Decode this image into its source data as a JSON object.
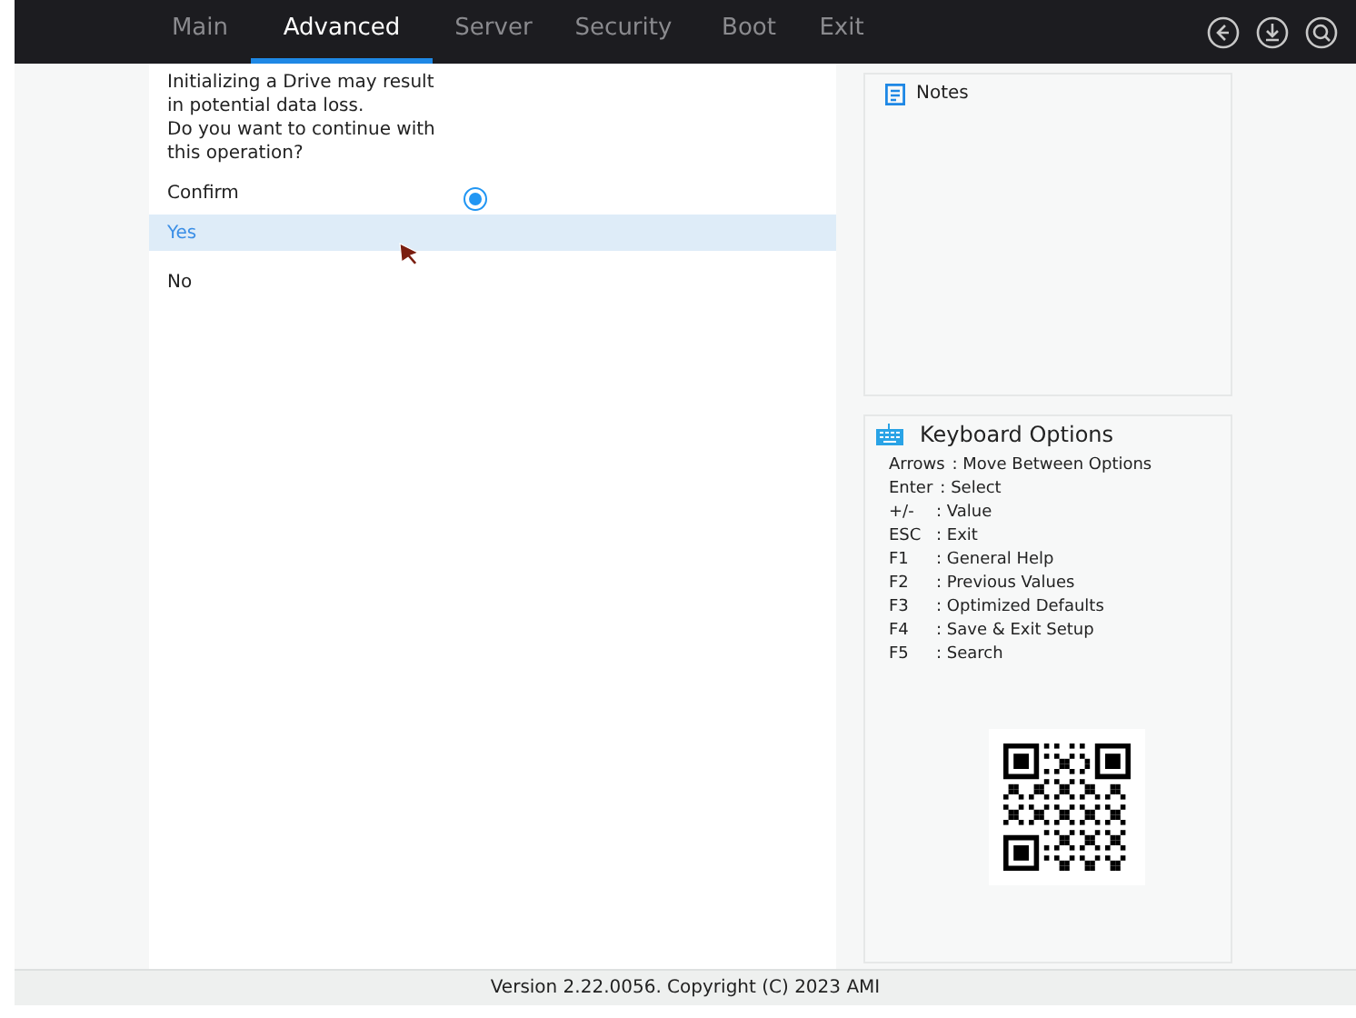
{
  "tabs": [
    {
      "label": "Main",
      "selected": false
    },
    {
      "label": "Advanced",
      "selected": true
    },
    {
      "label": "Server",
      "selected": false
    },
    {
      "label": "Security",
      "selected": false
    },
    {
      "label": "Boot",
      "selected": false
    },
    {
      "label": "Exit",
      "selected": false
    }
  ],
  "message": [
    "Initializing a Drive may result",
    "in potential data loss.",
    "Do you want to continue with",
    "this operation?"
  ],
  "confirm": {
    "label": "Confirm",
    "checked": true
  },
  "options": [
    {
      "label": "Yes",
      "selected": true
    },
    {
      "label": "No",
      "selected": false
    }
  ],
  "notes": {
    "title": "Notes"
  },
  "keyboard_options": {
    "title": "Keyboard Options",
    "keys": [
      {
        "key": "Arrows",
        "action": ": Move Between Options"
      },
      {
        "key": "Enter",
        "action": ": Select"
      },
      {
        "key": "+/-",
        "action": ": Value"
      },
      {
        "key": "ESC",
        "action": ": Exit"
      },
      {
        "key": "F1",
        "action": ": General Help"
      },
      {
        "key": "F2",
        "action": ": Previous Values"
      },
      {
        "key": "F3",
        "action": ": Optimized Defaults"
      },
      {
        "key": "F4",
        "action": ": Save & Exit Setup"
      },
      {
        "key": "F5",
        "action": ": Search"
      }
    ]
  },
  "status_bar": "Version 2.22.0056. Copyright (C) 2023 AMI"
}
